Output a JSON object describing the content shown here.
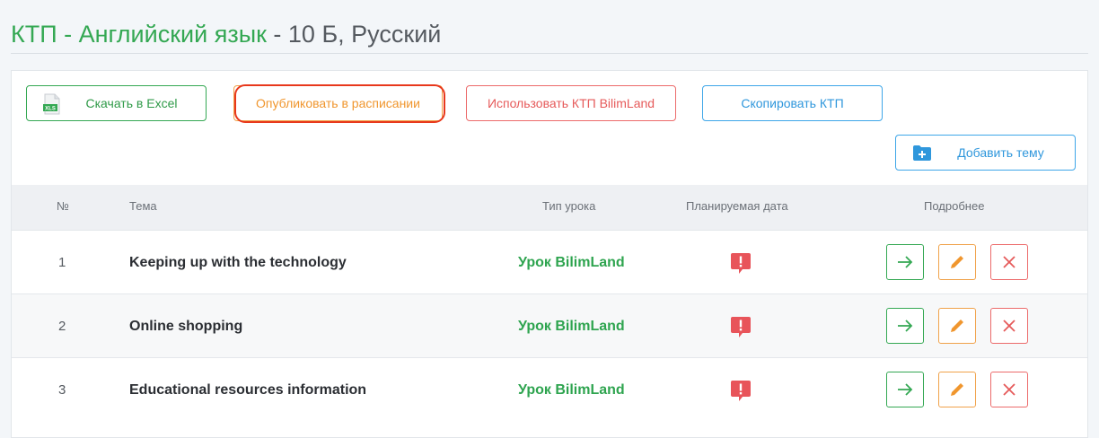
{
  "header": {
    "title_ktp": "КТП - Английский язык",
    "title_rest": " - 10 Б, Русский"
  },
  "toolbar": {
    "excel_label": "Скачать в Excel",
    "publish_label": "Опубликовать в расписании",
    "bilimland_label": "Использовать КТП BilimLand",
    "copy_label": "Скопировать КТП",
    "add_topic_label": "Добавить тему",
    "excel_icon_text": "XLS"
  },
  "table": {
    "headers": {
      "num": "№",
      "topic": "Тема",
      "type": "Тип урока",
      "date": "Планируемая дата",
      "details": "Подробнее"
    },
    "rows": [
      {
        "num": "1",
        "topic": "Keeping up with the technology",
        "type": "Урок BilimLand"
      },
      {
        "num": "2",
        "topic": "Online shopping",
        "type": "Урок BilimLand"
      },
      {
        "num": "3",
        "topic": "Educational resources information",
        "type": "Урок BilimLand"
      }
    ]
  },
  "colors": {
    "green": "#34a853",
    "orange": "#f0a24a",
    "red": "#ec6b6b",
    "blue": "#3ea6e8",
    "highlight": "#e8381c"
  },
  "icons": {
    "excel": "xls-file-icon",
    "add": "folder-plus-icon",
    "date_missing": "alert-comment-icon",
    "go": "arrow-right-icon",
    "edit": "pencil-icon",
    "delete": "close-icon"
  }
}
